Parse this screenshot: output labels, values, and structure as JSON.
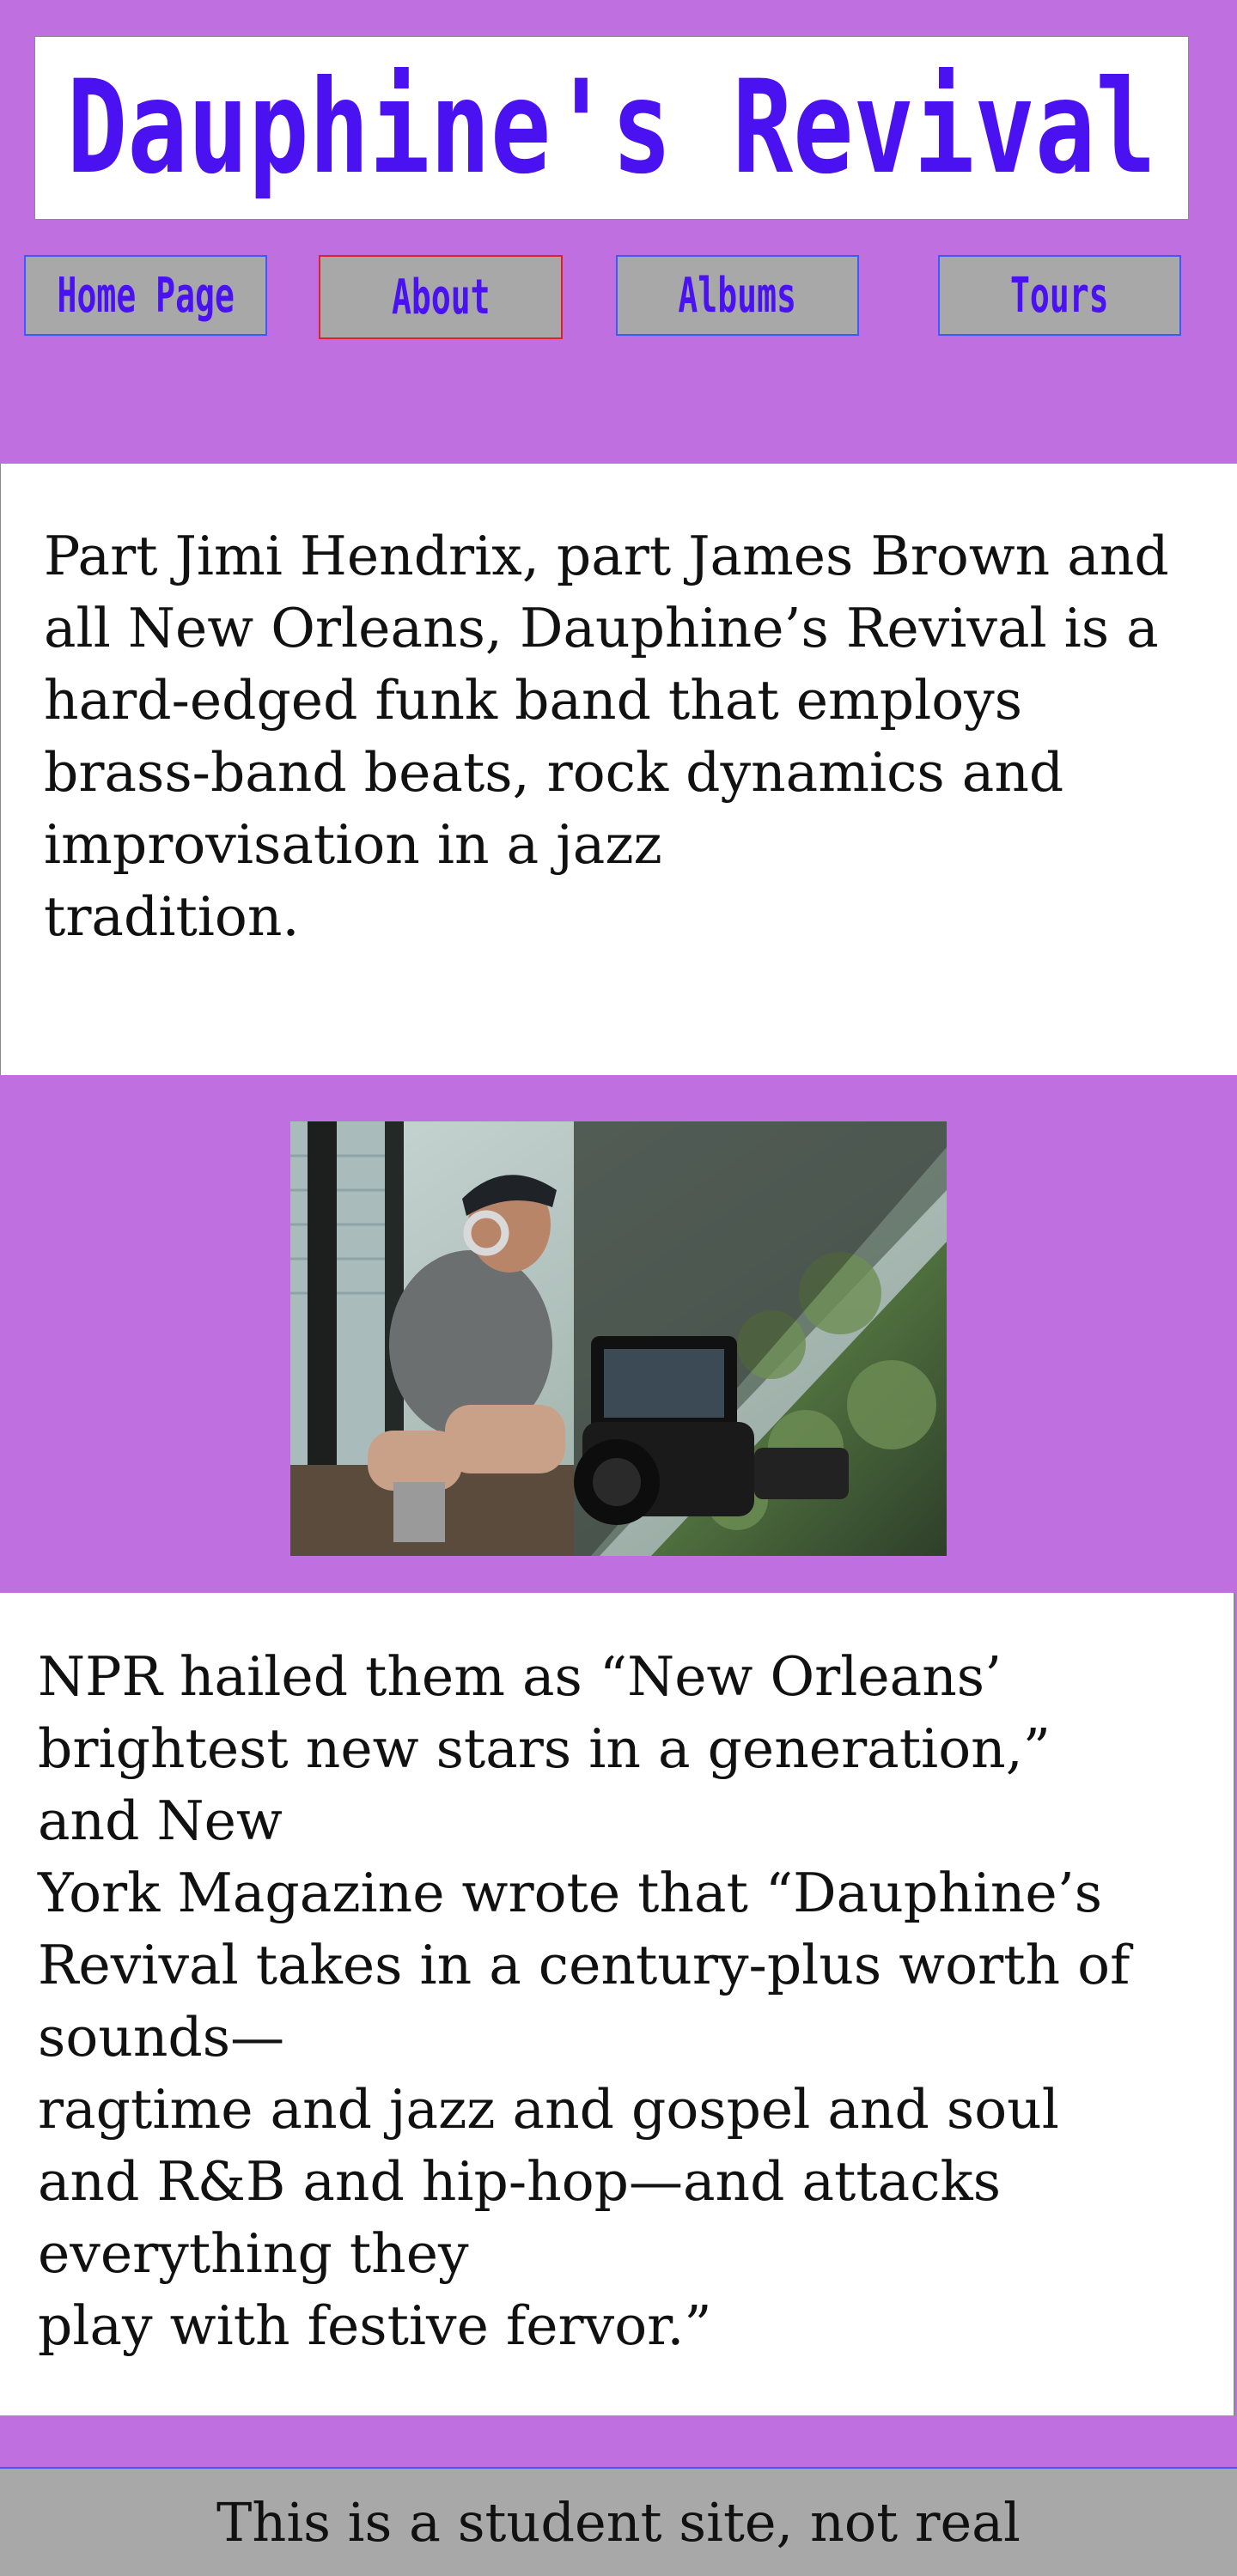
{
  "header": {
    "title": "Dauphine's Revival"
  },
  "nav": {
    "items": [
      {
        "label": "Home Page",
        "active": false
      },
      {
        "label": "About",
        "active": true
      },
      {
        "label": "Albums",
        "active": false
      },
      {
        "label": "Tours",
        "active": false
      }
    ]
  },
  "intro": {
    "lines": [
      "Part Jimi Hendrix, part James Brown and",
      "all New Orleans, Dauphine’s Revival is a",
      "hard-edged funk band that employs",
      "brass-band beats, rock dynamics and",
      "improvisation in a jazz",
      "tradition."
    ]
  },
  "photo": {
    "alt": "musician-with-camera"
  },
  "press": {
    "lines": [
      "NPR hailed them as “New Orleans’",
      "brightest new stars in a generation,”",
      "and New",
      "York Magazine wrote that “Dauphine’s",
      "Revival takes in a century-plus worth of",
      "sounds—",
      "ragtime and jazz and gospel and soul",
      "and R&B and hip-hop—and attacks",
      "everything they",
      "play with festive fervor.”"
    ]
  },
  "footer": {
    "text": "This is a student site, not real"
  },
  "colors": {
    "background": "#bf6fe0",
    "title": "#4a12f0",
    "nav_bg": "#a8a8a8",
    "nav_border": "#3b5bff",
    "nav_active_border": "#e0202a",
    "panel_bg": "#ffffff"
  }
}
